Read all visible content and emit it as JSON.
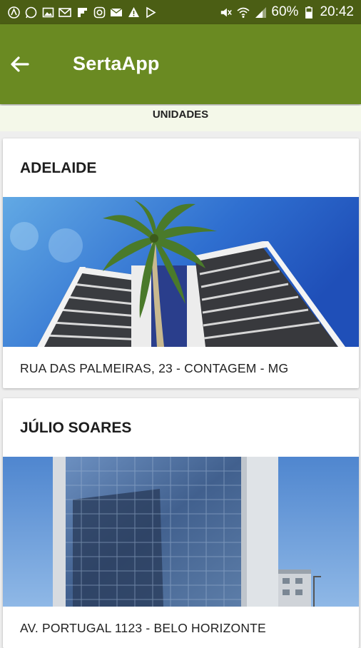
{
  "status_bar": {
    "battery": "60%",
    "time": "20:42",
    "icons": [
      "app-icon",
      "whatsapp-icon",
      "image-icon",
      "gmail-icon",
      "flipboard-icon",
      "instagram-icon",
      "email-icon",
      "warning-icon",
      "play-icon",
      "mute-icon",
      "wifi-icon",
      "signal-icon",
      "battery-icon"
    ]
  },
  "appbar": {
    "title": "SertaApp",
    "back_icon": "arrow-left-icon"
  },
  "subheader": {
    "label": "UNIDADES"
  },
  "units": [
    {
      "name": "ADELAIDE",
      "address": "RUA DAS PALMEIRAS, 23 - CONTAGEM - MG"
    },
    {
      "name": "JÚLIO SOARES",
      "address": "AV. PORTUGAL 1123 - BELO HORIZONTE"
    }
  ],
  "colors": {
    "status_bar": "#4b5e14",
    "app_bar": "#6a8a22",
    "subheader_bg": "#f4f8e9"
  }
}
